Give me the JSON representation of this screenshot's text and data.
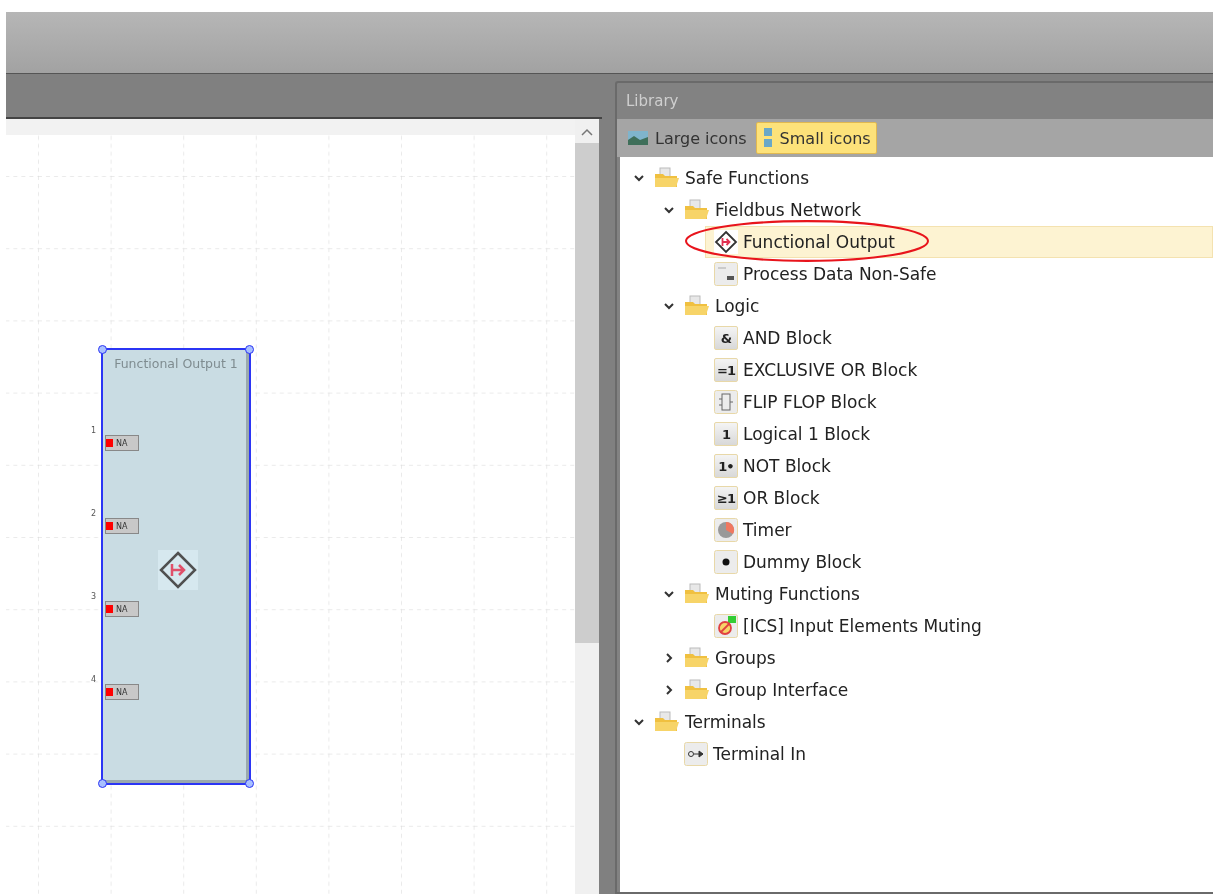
{
  "diagram": {
    "block": {
      "title": "Functional Output 1",
      "selected": true,
      "ports": [
        {
          "number": "1",
          "label": "NA"
        },
        {
          "number": "2",
          "label": "NA"
        },
        {
          "number": "3",
          "label": "NA"
        },
        {
          "number": "4",
          "label": "NA"
        }
      ]
    }
  },
  "library": {
    "title": "Library",
    "view_buttons": [
      {
        "label": "Large icons",
        "selected": false
      },
      {
        "label": "Small icons",
        "selected": true
      }
    ],
    "tree": [
      {
        "label": "Safe Functions",
        "kind": "folder",
        "expanded": true,
        "children": [
          {
            "label": "Fieldbus Network",
            "kind": "folder",
            "expanded": true,
            "children": [
              {
                "label": "Functional Output",
                "kind": "diamond",
                "selected": true,
                "circled": true
              },
              {
                "label": "Process Data Non-Safe",
                "kind": "process",
                "selected": false
              }
            ]
          },
          {
            "label": "Logic",
            "kind": "folder",
            "expanded": true,
            "children": [
              {
                "label": "AND Block",
                "kind": "glyph",
                "glyph": "&",
                "selected": false
              },
              {
                "label": "EXCLUSIVE OR Block",
                "kind": "glyph",
                "glyph": "=1",
                "selected": false
              },
              {
                "label": "FLIP FLOP Block",
                "kind": "flipflop",
                "selected": false
              },
              {
                "label": "Logical 1 Block",
                "kind": "glyph",
                "glyph": "1",
                "selected": false
              },
              {
                "label": "NOT Block",
                "kind": "glyph",
                "glyph": "1•",
                "selected": false
              },
              {
                "label": "OR Block",
                "kind": "glyph",
                "glyph": "≥1",
                "selected": false
              },
              {
                "label": "Timer",
                "kind": "timer",
                "selected": false
              },
              {
                "label": "Dummy Block",
                "kind": "dummy",
                "selected": false
              }
            ]
          },
          {
            "label": "Muting Functions",
            "kind": "folder",
            "expanded": true,
            "children": [
              {
                "label": "[ICS] Input Elements Muting",
                "kind": "muting",
                "selected": false
              }
            ]
          },
          {
            "label": "Groups",
            "kind": "folder",
            "expanded": false
          },
          {
            "label": "Group Interface",
            "kind": "folder",
            "expanded": false
          }
        ]
      },
      {
        "label": "Terminals",
        "kind": "folder",
        "expanded": true,
        "children": [
          {
            "label": "Terminal In",
            "kind": "terminal",
            "selected": false
          }
        ]
      }
    ]
  }
}
